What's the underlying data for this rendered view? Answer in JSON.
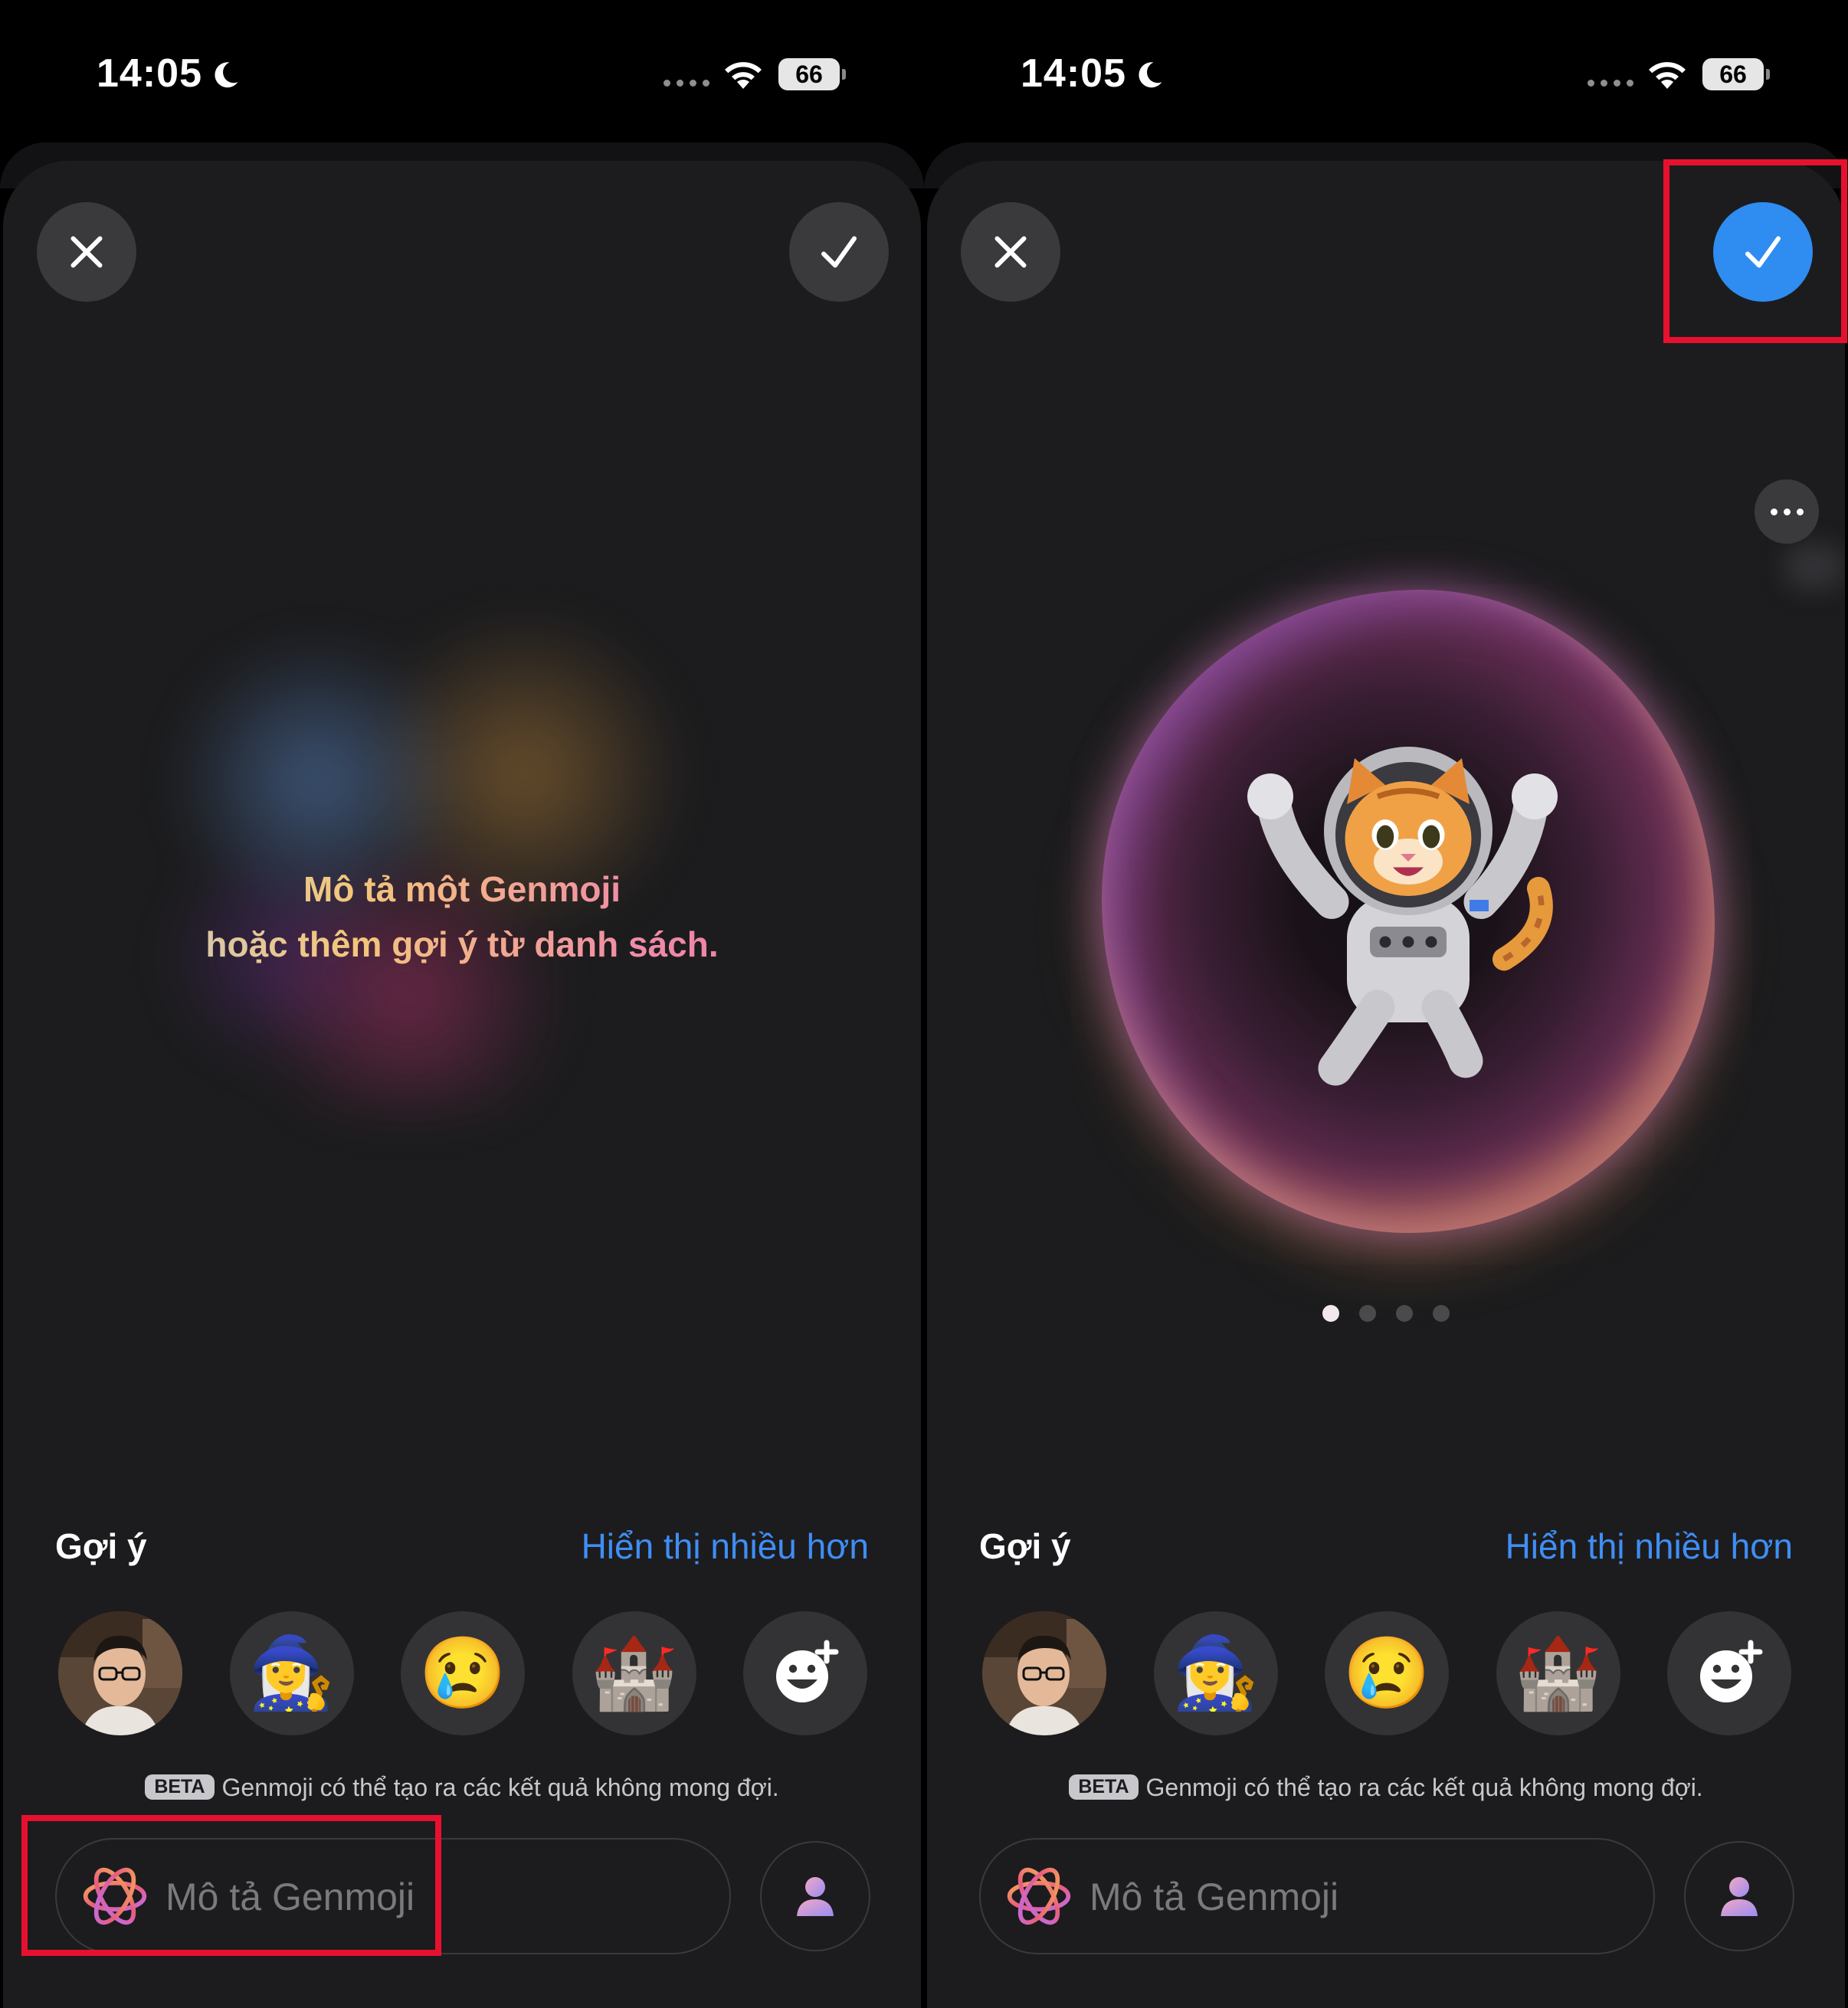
{
  "screens": [
    {
      "status": {
        "time": "14:05",
        "battery": "66"
      },
      "prompt_line1": "Mô tả một Genmoji",
      "prompt_line2": "hoặc thêm gợi ý từ danh sách.",
      "suggestions": {
        "title": "Gợi ý",
        "show_more": "Hiển thị nhiều hơn",
        "items": [
          "person-photo",
          "🧙‍♀️",
          "😢",
          "🏰",
          "add-emoji"
        ]
      },
      "beta_badge": "BETA",
      "beta_note": "Genmoji có thể tạo ra các kết quả không mong đợi.",
      "input_placeholder": "Mô tả Genmoji"
    },
    {
      "status": {
        "time": "14:05",
        "battery": "66"
      },
      "result": {
        "pages": 4,
        "current_page": 1,
        "subject": "cat astronaut"
      },
      "suggestions": {
        "title": "Gợi ý",
        "show_more": "Hiển thị nhiều hơn",
        "items": [
          "person-photo",
          "🧙‍♀️",
          "😢",
          "🏰",
          "add-emoji"
        ]
      },
      "beta_badge": "BETA",
      "beta_note": "Genmoji có thể tạo ra các kết quả không mong đợi.",
      "input_placeholder": "Mô tả Genmoji"
    }
  ],
  "colors": {
    "accent": "#3f8ef5",
    "confirm_active": "#2f8cf0",
    "highlight": "#e8102f",
    "sheet": "#1c1c1e"
  }
}
